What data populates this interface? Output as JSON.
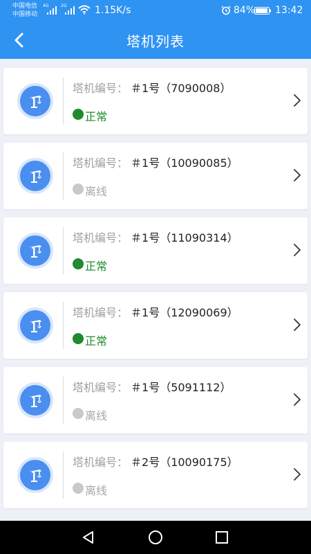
{
  "status_bar": {
    "carrier_1": "中国电信",
    "carrier_2": "中国移动",
    "net_type_1": "4G",
    "net_type_2": "2G",
    "speed": "1.15K/s",
    "battery": "84%",
    "time": "13:42"
  },
  "header": {
    "title": "塔机列表"
  },
  "colors": {
    "header_bg": "#2f93f2",
    "status_online": "#1f8a2e",
    "status_offline": "#c9c9c9",
    "avatar_bg": "#4a8ef0"
  },
  "list": {
    "code_label": "塔机编号：",
    "items": [
      {
        "code": "＃1号（7090008）",
        "status": "正常",
        "online": true
      },
      {
        "code": "＃1号（10090085）",
        "status": "离线",
        "online": false
      },
      {
        "code": "＃1号（11090314）",
        "status": "正常",
        "online": true
      },
      {
        "code": "＃1号（12090069）",
        "status": "正常",
        "online": true
      },
      {
        "code": "＃1号（5091112）",
        "status": "离线",
        "online": false
      },
      {
        "code": "＃2号（10090175）",
        "status": "离线",
        "online": false
      }
    ]
  },
  "icons": {
    "back": "chevron-left-icon",
    "item": "tower-crane-icon",
    "row_arrow": "chevron-right-icon",
    "nav": [
      "back-triangle-icon",
      "home-circle-icon",
      "recents-square-icon"
    ]
  }
}
